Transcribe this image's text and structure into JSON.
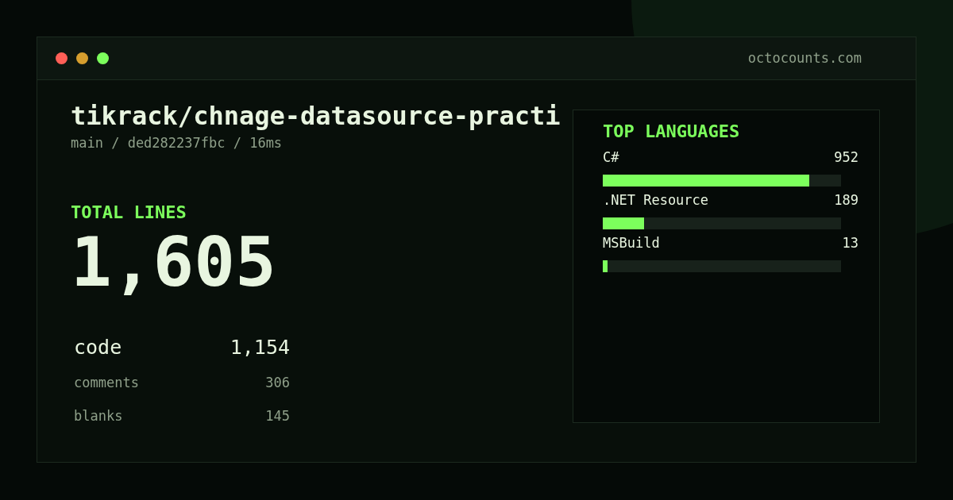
{
  "window": {
    "url": "octocounts.com"
  },
  "repo": {
    "title": "tikrack/chnage-datasource-practi",
    "meta": "main / ded282237fbc / 16ms"
  },
  "total": {
    "label": "TOTAL LINES",
    "value": "1,605"
  },
  "stats": [
    {
      "kind": "primary",
      "label": "code",
      "value": "1,154"
    },
    {
      "kind": "secondary",
      "label": "comments",
      "value": "306"
    },
    {
      "kind": "secondary",
      "label": "blanks",
      "value": "145"
    }
  ],
  "languages": {
    "title": "TOP LANGUAGES",
    "items": [
      {
        "name": "C#",
        "value": "952",
        "level": 0.867
      },
      {
        "name": ".NET Resource",
        "value": "189",
        "level": 0.172
      },
      {
        "name": "MSBuild",
        "value": "13",
        "level": 0.02
      }
    ]
  }
}
